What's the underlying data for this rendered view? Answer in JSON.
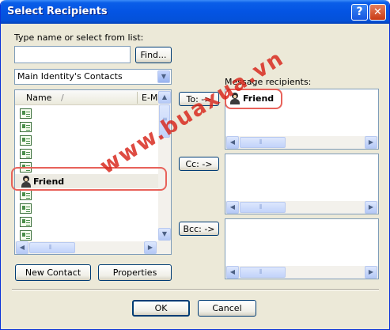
{
  "window": {
    "title": "Select Recipients",
    "help_button": "?",
    "close_button": "✕"
  },
  "search": {
    "label": "Type name or select from list:",
    "value": "",
    "find_button": "Find..."
  },
  "contacts_source": {
    "selected": "Main Identity's Contacts"
  },
  "contact_list": {
    "columns": [
      "Name",
      "E-M"
    ],
    "sort_indicator": "/",
    "rows": [
      {
        "name": "",
        "icon": "contact-card-icon"
      },
      {
        "name": "",
        "icon": "contact-card-icon"
      },
      {
        "name": "",
        "icon": "contact-card-icon"
      },
      {
        "name": "",
        "icon": "contact-card-icon"
      },
      {
        "name": "",
        "icon": "contact-card-icon"
      },
      {
        "name": "Friend",
        "icon": "person-icon"
      },
      {
        "name": "",
        "icon": "contact-card-icon"
      },
      {
        "name": "",
        "icon": "contact-card-icon"
      },
      {
        "name": "",
        "icon": "contact-card-icon"
      },
      {
        "name": "",
        "icon": "contact-card-icon"
      }
    ]
  },
  "buttons": {
    "to": "To: ->",
    "cc": "Cc: ->",
    "bcc": "Bcc: ->",
    "new_contact": "New Contact",
    "properties": "Properties",
    "ok": "OK",
    "cancel": "Cancel"
  },
  "recipients": {
    "label": "Message recipients:",
    "to": [
      "Friend"
    ],
    "cc": [],
    "bcc": []
  },
  "watermark": "www.buaxua.vn",
  "colors": {
    "title_bar": "#0454e3",
    "highlight": "#e8625a",
    "watermark": "#d72319"
  }
}
